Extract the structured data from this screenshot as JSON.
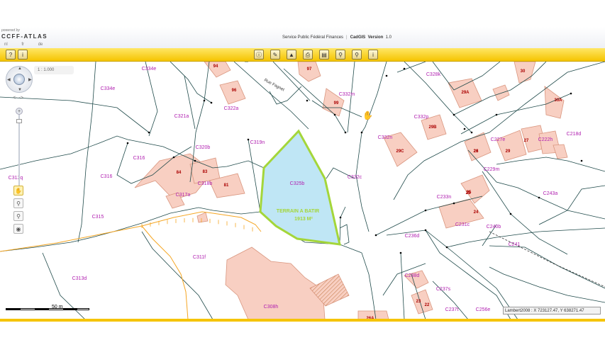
{
  "header": {
    "powered_by": "powered by",
    "brand": "CCFF-ATLAS",
    "service": "Service Public Fédéral Finances",
    "app_name": "CadGIS",
    "version_label": "Version",
    "version": "1.0",
    "languages": [
      "nl",
      "fr",
      "de"
    ]
  },
  "toolbar": {
    "left_icons": [
      "help-icon",
      "info-icon"
    ],
    "center_icons": [
      "identify-icon",
      "measure-icon",
      "draw-icon",
      "print-icon",
      "document-icon",
      "search-address-icon",
      "search-parcel-icon",
      "information-icon"
    ]
  },
  "nav": {
    "scale_display": "1 : 1.000",
    "zoom_arrows": "<- ->",
    "side_tools": [
      "pan-hand-icon",
      "zoom-in-icon",
      "zoom-out-icon",
      "full-extent-icon"
    ]
  },
  "map": {
    "parcel_labels": [
      "C334e",
      "C334e",
      "C321a",
      "C322a",
      "C319n",
      "C332m",
      "C328k",
      "C332p",
      "C332n",
      "C316",
      "C316",
      "C320b",
      "C318b",
      "C317a",
      "C315",
      "C313q",
      "C332c",
      "C325b",
      "C233n",
      "C229m",
      "C227e",
      "C222h",
      "C218d",
      "C243a",
      "C231c",
      "C240b",
      "C236d",
      "C241",
      "C311f",
      "C313d",
      "C238d",
      "C237s",
      "C237t",
      "C256e",
      "C308h"
    ],
    "house_numbers": [
      "94",
      "97",
      "96",
      "99",
      "30",
      "29A",
      "30A",
      "29B",
      "29C",
      "28",
      "29",
      "27",
      "25",
      "26",
      "25",
      "24",
      "84",
      "83",
      "81",
      "22",
      "23",
      "26A"
    ],
    "street_name": "Rue Fagnet",
    "selected_parcel": {
      "id": "C325b",
      "label_line1": "TERRAIN A BATIR",
      "label_line2": "1913 M²"
    },
    "colors": {
      "parcel_line": "#1f4a4a",
      "building_fill": "#f8cfc2",
      "building_stroke": "#d9967f",
      "parcel_label": "#b01fb0",
      "house_number": "#aa0000",
      "selection_fill": "#bfe6f5",
      "selection_stroke": "#a4d63a",
      "orange_line": "#f5a623"
    }
  },
  "footer": {
    "scale_label": "50 m",
    "coordinates": "Lambert2008 : X 723127.47, Y 638271.47"
  }
}
